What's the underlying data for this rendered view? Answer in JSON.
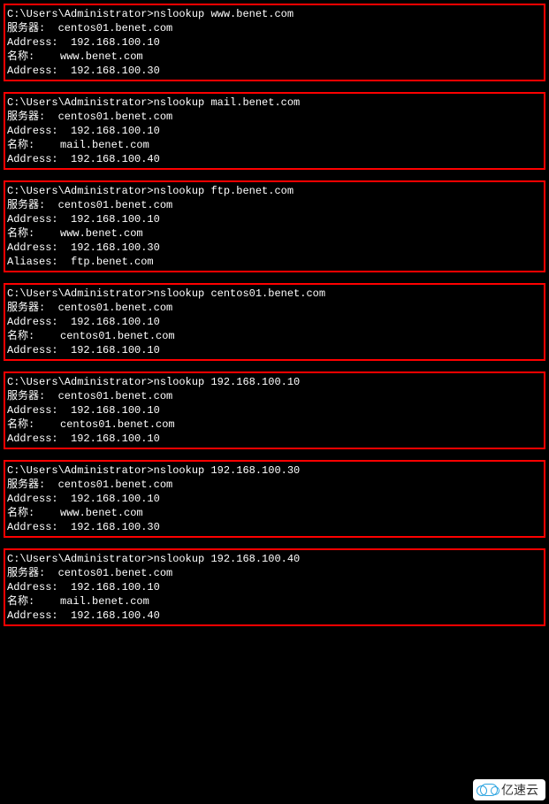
{
  "prompt": "C:\\Users\\Administrator>",
  "labels": {
    "server": "服务器:  ",
    "address": "Address:  ",
    "name": "名称:    ",
    "aliases": "Aliases:  "
  },
  "blocks": [
    {
      "cmd": "nslookup www.benet.com",
      "server": "centos01.benet.com",
      "server_addr": "192.168.100.10",
      "name": "www.benet.com",
      "name_addr": "192.168.100.30"
    },
    {
      "cmd": "nslookup mail.benet.com",
      "server": "centos01.benet.com",
      "server_addr": "192.168.100.10",
      "name": "mail.benet.com",
      "name_addr": "192.168.100.40"
    },
    {
      "cmd": "nslookup ftp.benet.com",
      "server": "centos01.benet.com",
      "server_addr": "192.168.100.10",
      "name": "www.benet.com",
      "name_addr": "192.168.100.30",
      "aliases": "ftp.benet.com"
    },
    {
      "cmd": "nslookup centos01.benet.com",
      "server": "centos01.benet.com",
      "server_addr": "192.168.100.10",
      "name": "centos01.benet.com",
      "name_addr": "192.168.100.10"
    },
    {
      "cmd": "nslookup 192.168.100.10",
      "server": "centos01.benet.com",
      "server_addr": "192.168.100.10",
      "name": "centos01.benet.com",
      "name_addr": "192.168.100.10"
    },
    {
      "cmd": "nslookup 192.168.100.30",
      "server": "centos01.benet.com",
      "server_addr": "192.168.100.10",
      "name": "www.benet.com",
      "name_addr": "192.168.100.30"
    },
    {
      "cmd": "nslookup 192.168.100.40",
      "server": "centos01.benet.com",
      "server_addr": "192.168.100.10",
      "name": "mail.benet.com",
      "name_addr": "192.168.100.40"
    }
  ],
  "watermark": "亿速云"
}
